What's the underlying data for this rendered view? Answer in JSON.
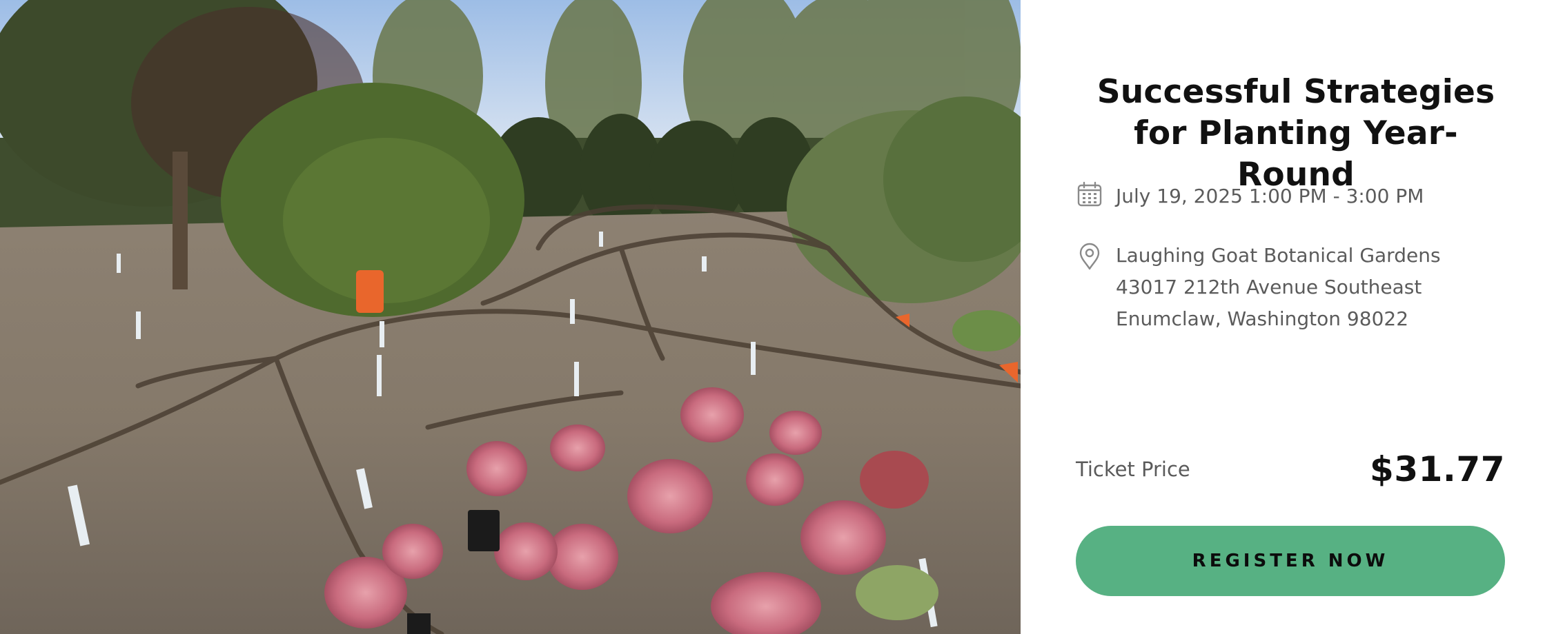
{
  "event": {
    "title": "Successful Strategies for Planting Year-Round",
    "datetime": "July 19, 2025 1:00 PM - 3:00 PM",
    "location": {
      "venue": "Laughing Goat Botanical Gardens",
      "street": "43017 212th Avenue Southeast",
      "city": "Enumclaw, Washington 98022"
    },
    "price_label": "Ticket Price",
    "price": "$31.77",
    "register_label": "REGISTER NOW"
  },
  "icons": {
    "date": "calendar-icon",
    "location": "map-pin-icon"
  },
  "colors": {
    "accent": "#57b183",
    "title": "#111111",
    "body_text": "#5b5b5b"
  },
  "image": {
    "description_name": "garden-bed-photo"
  }
}
